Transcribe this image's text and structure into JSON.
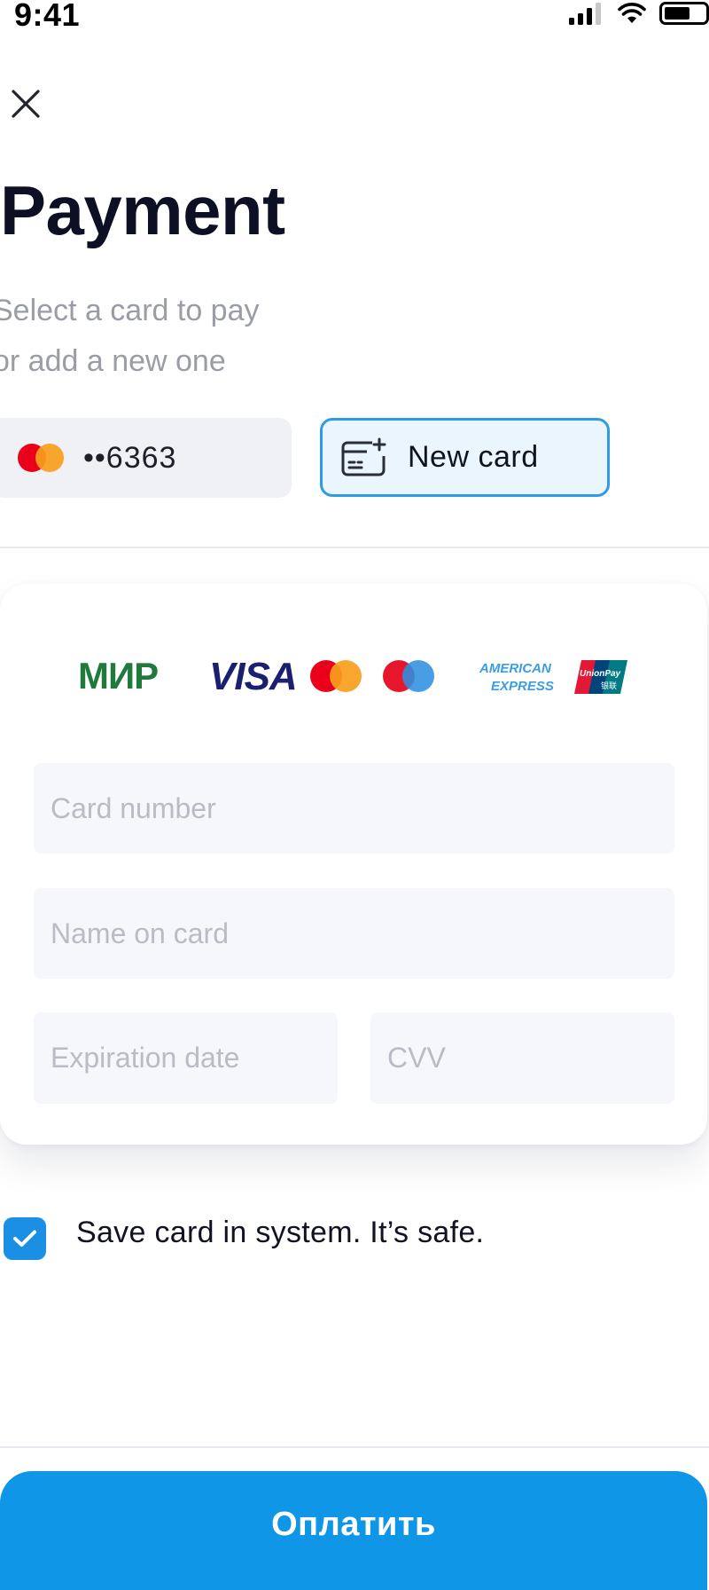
{
  "status_bar": {
    "time": "9:41",
    "icons": [
      "signal-icon",
      "wifi-icon",
      "battery-icon"
    ]
  },
  "header": {
    "close_icon": "close-icon",
    "title": "Payment",
    "subtitle": "Select a card to pay\nor add a new one"
  },
  "saved_cards": [
    {
      "brand": "mastercard",
      "masked_number": "••6363",
      "selected": false
    }
  ],
  "new_card": {
    "label": "New card",
    "icon": "add-card-icon",
    "selected": true
  },
  "accepted_brands": {
    "items": [
      "МИР",
      "VISA",
      "Mastercard",
      "Maestro",
      "American Express",
      "UnionPay"
    ],
    "mir_label": "МИР",
    "visa_label": "VISA",
    "amex_line1": "AMERICAN",
    "amex_line2": "EXPRESS",
    "unionpay_label": "UnionPay",
    "unionpay_sub": "银联"
  },
  "form": {
    "card_number": {
      "placeholder": "Card number",
      "value": ""
    },
    "name_on_card": {
      "placeholder": "Name on card",
      "value": ""
    },
    "expiration_date": {
      "placeholder": "Expiration date",
      "value": ""
    },
    "cvv": {
      "placeholder": "CVV",
      "value": ""
    }
  },
  "save_card": {
    "checked": true,
    "label": "Save card in system. It’s safe."
  },
  "pay_button": {
    "label": "Оплатить"
  },
  "colors": {
    "accent": "#0f96e6",
    "chip_selected_border": "#2f9be6",
    "chip_selected_bg": "#eaf5fd",
    "field_bg": "#f6f7fb",
    "placeholder": "#b9bbc5"
  }
}
